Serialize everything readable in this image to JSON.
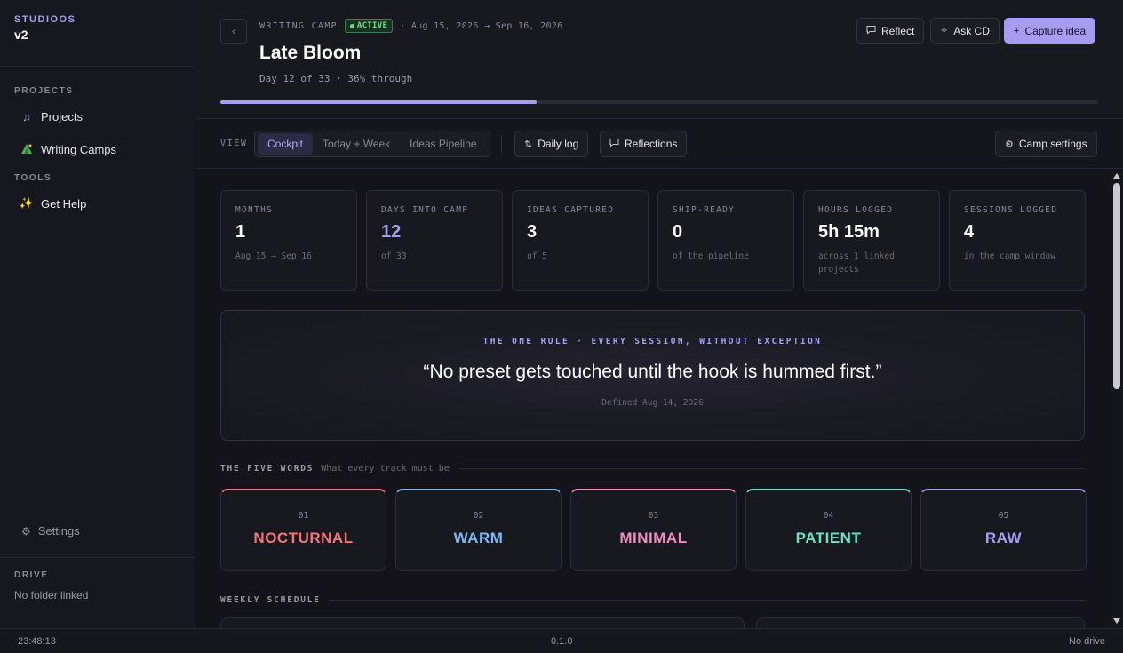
{
  "sidebar": {
    "brand": "STUDIOOS",
    "version": "v2",
    "projects_section": "PROJECTS",
    "tools_section": "TOOLS",
    "items": [
      {
        "label": "Projects",
        "icon": "music-note-icon"
      },
      {
        "label": "Writing Camps",
        "icon": "camp-tent-icon"
      },
      {
        "label": "Get Help",
        "icon": "sparkles-icon"
      }
    ],
    "settings_label": "Settings",
    "drive_label": "DRIVE",
    "drive_value": "No folder linked"
  },
  "header": {
    "eyebrow": "WRITING CAMP",
    "status_badge": "ACTIVE",
    "date_range": "· Aug 15, 2026 → Sep 16, 2026",
    "title": "Late Bloom",
    "subtitle": "Day 12 of 33 · 36% through",
    "progress_fraction": 0.36,
    "buttons": {
      "reflect": "Reflect",
      "ask_cd": "Ask CD",
      "capture": "Capture idea"
    }
  },
  "viewbar": {
    "label": "VIEW",
    "tabs": [
      "Cockpit",
      "Today + Week",
      "Ideas Pipeline"
    ],
    "active_tab": "Cockpit",
    "daily_log": "Daily log",
    "reflections": "Reflections",
    "camp_settings": "Camp settings"
  },
  "stats": [
    {
      "label": "MONTHS",
      "value": "1",
      "sub": "Aug 15 → Sep 16"
    },
    {
      "label": "DAYS INTO CAMP",
      "value": "12",
      "sub": "of 33"
    },
    {
      "label": "IDEAS CAPTURED",
      "value": "3",
      "sub": "of 5"
    },
    {
      "label": "SHIP-READY",
      "value": "0",
      "sub": "of the pipeline"
    },
    {
      "label": "HOURS LOGGED",
      "value": "5h 15m",
      "sub": "across 1 linked projects"
    },
    {
      "label": "SESSIONS LOGGED",
      "value": "4",
      "sub": "in the camp window"
    }
  ],
  "one_rule": {
    "eyebrow": "THE ONE RULE · EVERY SESSION, WITHOUT EXCEPTION",
    "quote": "“No preset gets touched until the hook is hummed first.”",
    "defined": "Defined Aug 14, 2026"
  },
  "five_words": {
    "title": "THE FIVE WORDS",
    "subtitle": "What every track must be",
    "words": [
      {
        "num": "01",
        "word": "NOCTURNAL",
        "color": "#f0767e"
      },
      {
        "num": "02",
        "word": "WARM",
        "color": "#7ab8f5"
      },
      {
        "num": "03",
        "word": "MINIMAL",
        "color": "#f08cc0"
      },
      {
        "num": "04",
        "word": "PATIENT",
        "color": "#6fe0c8"
      },
      {
        "num": "05",
        "word": "RAW",
        "color": "#a99cf0"
      }
    ]
  },
  "schedule": {
    "title": "WEEKLY SCHEDULE"
  },
  "statusbar": {
    "time": "23:48:13",
    "version": "0.1.0",
    "drive": "No drive"
  }
}
